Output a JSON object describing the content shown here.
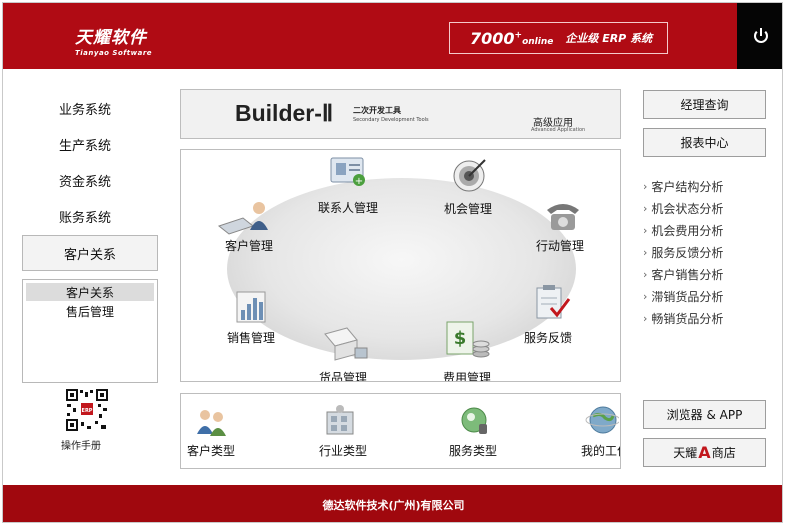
{
  "header": {
    "logo_cn": "天耀软件",
    "logo_en": "Tianyao Software",
    "erp_version": "7000",
    "erp_online": "online",
    "erp_subtitle": "企业级 ERP 系统",
    "power_icon": "power-icon"
  },
  "sidebar": {
    "items": [
      {
        "label": "业务系统"
      },
      {
        "label": "生产系统"
      },
      {
        "label": "资金系统"
      },
      {
        "label": "账务系统"
      },
      {
        "label": "客户关系"
      }
    ],
    "sub_items": [
      {
        "label": "客户关系"
      },
      {
        "label": "售后管理"
      }
    ],
    "qr_icon": "qr-code-icon",
    "manual_label": "操作手册"
  },
  "builder": {
    "title": "Builder-Ⅱ",
    "title_cn": "二次开发工具",
    "title_en": "Secondary Development Tools",
    "advanced_cn": "高级应用",
    "advanced_en": "Advanced Application"
  },
  "modules": [
    {
      "label": "联系人管理",
      "icon": "contact-card-icon"
    },
    {
      "label": "机会管理",
      "icon": "target-icon"
    },
    {
      "label": "客户管理",
      "icon": "customer-icon"
    },
    {
      "label": "行动管理",
      "icon": "telephone-icon"
    },
    {
      "label": "销售管理",
      "icon": "sales-chart-icon"
    },
    {
      "label": "服务反馈",
      "icon": "clipboard-check-icon"
    },
    {
      "label": "货品管理",
      "icon": "goods-icon"
    },
    {
      "label": "费用管理",
      "icon": "expense-icon"
    }
  ],
  "categories": [
    {
      "label": "客户类型",
      "icon": "people-icon"
    },
    {
      "label": "行业类型",
      "icon": "industry-icon"
    },
    {
      "label": "服务类型",
      "icon": "service-icon"
    },
    {
      "label": "我的工作",
      "icon": "globe-icon"
    }
  ],
  "right": {
    "manager_query": "经理查询",
    "report_center": "报表中心",
    "analysis": [
      {
        "label": "客户结构分析"
      },
      {
        "label": "机会状态分析"
      },
      {
        "label": "机会费用分析"
      },
      {
        "label": "服务反馈分析"
      },
      {
        "label": "客户销售分析"
      },
      {
        "label": "滞销货品分析"
      },
      {
        "label": "畅销货品分析"
      }
    ],
    "browser_app": "浏览器 & APP",
    "store_prefix": "天耀",
    "store_letter": "A",
    "store_suffix": "商店"
  },
  "footer": {
    "company": "德达软件技术(广州)有限公司"
  },
  "colors": {
    "brand_red": "#b00b14",
    "footer_red": "#a0080e",
    "power_bg": "#050505"
  }
}
